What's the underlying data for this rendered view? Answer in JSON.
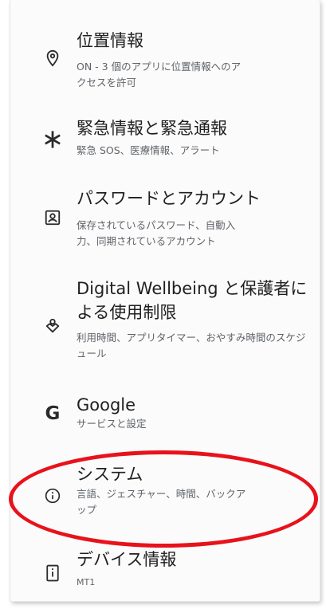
{
  "settings": {
    "items": [
      {
        "icon": "location-pin-icon",
        "title": "位置情報",
        "subtitle": "ON - 3 個のアプリに位置情報へのアクセスを許可"
      },
      {
        "icon": "asterisk-icon",
        "title": "緊急情報と緊急通報",
        "subtitle": "緊急 SOS、医療情報、アラート"
      },
      {
        "icon": "account-box-icon",
        "title": "パスワードとアカウント",
        "subtitle": "保存されているパスワード、自動入力、同期されているアカウント"
      },
      {
        "icon": "digital-wellbeing-icon",
        "title": "Digital Wellbeing と保護者による使用制限",
        "subtitle": "利用時間、アプリタイマー、おやすみ時間のスケジュール"
      },
      {
        "icon": "google-g-icon",
        "title": "Google",
        "subtitle": "サービスと設定"
      },
      {
        "icon": "info-icon",
        "title": "システム",
        "subtitle": "言語、ジェスチャー、時間、バックアップ"
      },
      {
        "icon": "device-info-icon",
        "title": "デバイス情報",
        "subtitle": "MT1"
      }
    ]
  },
  "annotation": {
    "color": "#e8121b",
    "target": "system-item"
  }
}
